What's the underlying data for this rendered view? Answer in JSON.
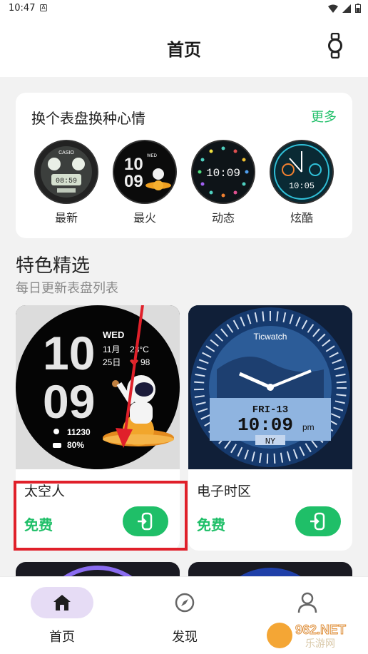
{
  "status_bar": {
    "time": "10:47",
    "notif_icon": "A"
  },
  "header": {
    "title": "首页",
    "watch_icon": "watch-icon"
  },
  "themes_card": {
    "title": "换个表盘换种心情",
    "more": "更多",
    "categories": [
      {
        "label": "最新",
        "face": "CASIO"
      },
      {
        "label": "最火",
        "face": "10 09"
      },
      {
        "label": "动态",
        "face": "10:09"
      },
      {
        "label": "炫酷",
        "face": "10:05"
      }
    ]
  },
  "featured": {
    "title": "特色精选",
    "subtitle": "每日更新表盘列表",
    "items": [
      {
        "name": "太空人",
        "price": "免费",
        "face": {
          "hour": "10",
          "minute": "09",
          "weekday": "WED",
          "month": "11月",
          "day": "25日",
          "temp": "23°C",
          "heart": "98",
          "steps": "11230",
          "battery": "80%"
        }
      },
      {
        "name": "电子时区",
        "price": "免费",
        "face": {
          "brand": "Ticwatch",
          "day": "FRI-13",
          "time": "10:09",
          "ampm": "pm",
          "city": "NY"
        }
      }
    ]
  },
  "bottom_nav": {
    "items": [
      {
        "label": "首页",
        "icon": "home-icon",
        "active": true
      },
      {
        "label": "发现",
        "icon": "compass-icon",
        "active": false
      },
      {
        "label": "",
        "icon": "user-icon",
        "active": false
      }
    ]
  },
  "watermark": {
    "brand": "962.NET",
    "sub": "乐游网"
  },
  "colors": {
    "accent": "#1fbf68",
    "highlight": "#e0202a",
    "nav_active": "#e6dcf5"
  }
}
